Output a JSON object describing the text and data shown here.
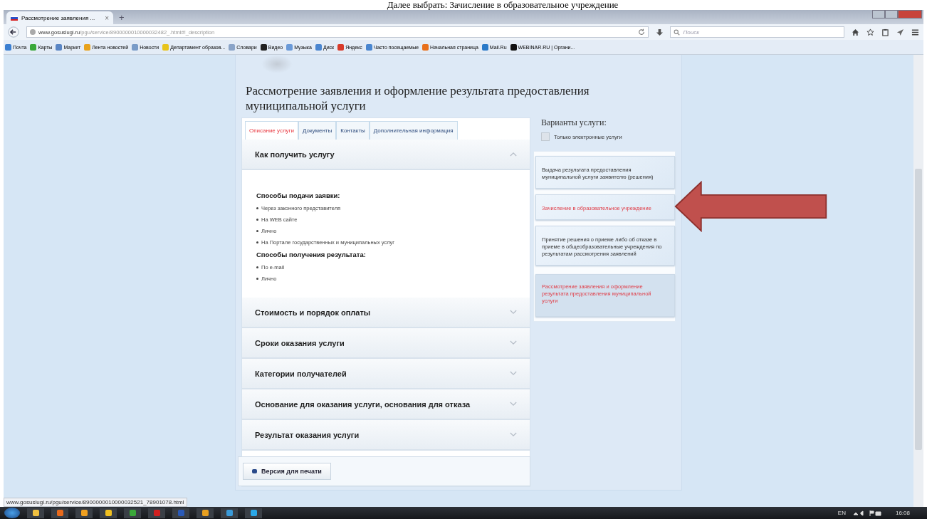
{
  "caption": "Далее выбрать: Зачисление в образовательное учреждение",
  "browser": {
    "tab_title": "Рассмотрение заявления ...",
    "tab_close": "×",
    "new_tab": "+",
    "url_host": "www.gosuslugi.ru",
    "url_path": "/pgu/service/8900000010000032482_.html#!_description",
    "search_placeholder": "Поиск",
    "bookmarks": [
      {
        "label": "Почта",
        "color": "#3b7fd1"
      },
      {
        "label": "Карты",
        "color": "#3aa83a"
      },
      {
        "label": "Маркет",
        "color": "#5a86c5"
      },
      {
        "label": "Лента новостей",
        "color": "#e8a21c"
      },
      {
        "label": "Новости",
        "color": "#7a9cc8"
      },
      {
        "label": "Департамент образов...",
        "color": "#e8c41c"
      },
      {
        "label": "Словари",
        "color": "#8aa4c8"
      },
      {
        "label": "Видео",
        "color": "#222222"
      },
      {
        "label": "Музыка",
        "color": "#6a9ad8"
      },
      {
        "label": "Диск",
        "color": "#4a86d0"
      },
      {
        "label": "Яндекс",
        "color": "#d83a2a"
      },
      {
        "label": "Часто посещаемые",
        "color": "#4a86d0"
      },
      {
        "label": "Начальная страница",
        "color": "#e8701c"
      },
      {
        "label": "Mail.Ru",
        "color": "#2a7ac8"
      },
      {
        "label": "WEBINAR.RU | Органи...",
        "color": "#111111"
      }
    ]
  },
  "page": {
    "title": "Рассмотрение заявления и оформление результата предоставления муниципальной услуги",
    "tabs": [
      {
        "label": "Описание услуги",
        "selected": true
      },
      {
        "label": "Документы",
        "selected": false
      },
      {
        "label": "Контакты",
        "selected": false
      },
      {
        "label": "Дополнительная информация",
        "selected": false
      }
    ],
    "sections": [
      {
        "title": "Как получить услугу",
        "expanded": true,
        "groups": [
          {
            "heading": "Способы подачи заявки:",
            "items": [
              "Через законного представителя",
              "На WEB сайте",
              "Лично",
              "На Портале государственных и муниципальных услуг"
            ]
          },
          {
            "heading": "Способы получения результата:",
            "items": [
              "По e-mail",
              "Лично"
            ]
          }
        ]
      },
      {
        "title": "Стоимость и порядок оплаты",
        "expanded": false
      },
      {
        "title": "Сроки оказания услуги",
        "expanded": false
      },
      {
        "title": "Категории получателей",
        "expanded": false
      },
      {
        "title": "Основание для оказания услуги, основания для отказа",
        "expanded": false
      },
      {
        "title": "Результат оказания услуги",
        "expanded": false
      }
    ],
    "print_button": "Версия для печати",
    "variants_title": "Варианты услуги:",
    "electronic_only": {
      "label": "Только электронные услуги",
      "checked": false
    },
    "variants": [
      {
        "text": "Выдача результата предоставления муниципальной услуги заявителю (решения)",
        "highlighted": false,
        "selected": false
      },
      {
        "text": "Зачисление в образовательное учреждение",
        "highlighted": true,
        "selected": false
      },
      {
        "text": "Принятие решения о приеме либо об отказе в приеме в общеобразовательные учреждения по результатам рассмотрения заявлений",
        "highlighted": false,
        "selected": false
      },
      {
        "text": "Рассмотрение заявления и оформление результата предоставления муниципальной услуги",
        "highlighted": true,
        "selected": true
      }
    ]
  },
  "status_url": "www.gosuslugi.ru/pgu/service/8900000010000032521_78901078.html",
  "taskbar": {
    "language": "EN",
    "time": "16:08"
  }
}
